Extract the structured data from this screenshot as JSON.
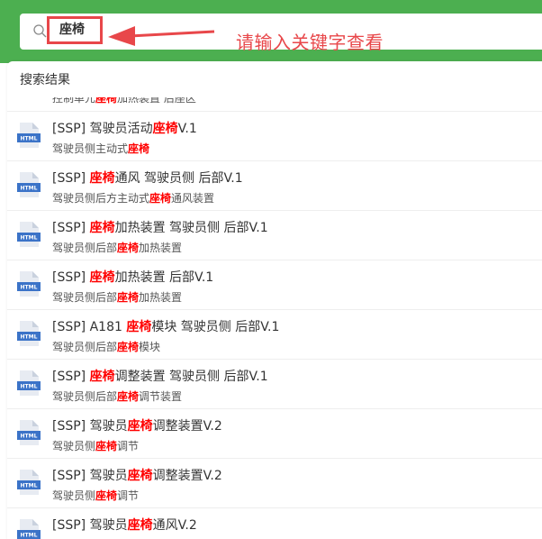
{
  "search": {
    "value": "座椅"
  },
  "hint": "请输入关键字查看",
  "results_header": "搜索结果",
  "partial_row": {
    "pre": "控制单元",
    "kw": "座椅",
    "post": "加热装置 后座区"
  },
  "colors": {
    "brand_green": "#4caf50",
    "annotation_red": "#e8474a",
    "highlight": "#ff0000"
  },
  "file_type_icon": "HTML",
  "results": [
    {
      "t_pre": "[SSP] 驾驶员活动",
      "t_kw": "座椅",
      "t_post": "V.1",
      "s_pre": "驾驶员侧主动式",
      "s_kw": "座椅",
      "s_post": ""
    },
    {
      "t_pre": "[SSP] ",
      "t_kw": "座椅",
      "t_post": "通风 驾驶员侧 后部V.1",
      "s_pre": "驾驶员侧后方主动式",
      "s_kw": "座椅",
      "s_post": "通风装置"
    },
    {
      "t_pre": "[SSP] ",
      "t_kw": "座椅",
      "t_post": "加热装置 驾驶员侧 后部V.1",
      "s_pre": "驾驶员侧后部",
      "s_kw": "座椅",
      "s_post": "加热装置"
    },
    {
      "t_pre": "[SSP] ",
      "t_kw": "座椅",
      "t_post": "加热装置 后部V.1",
      "s_pre": "驾驶员侧后部",
      "s_kw": "座椅",
      "s_post": "加热装置"
    },
    {
      "t_pre": "[SSP] A181 ",
      "t_kw": "座椅",
      "t_post": "模块 驾驶员侧 后部V.1",
      "s_pre": "驾驶员侧后部",
      "s_kw": "座椅",
      "s_post": "模块"
    },
    {
      "t_pre": "[SSP] ",
      "t_kw": "座椅",
      "t_post": "调整装置 驾驶员侧 后部V.1",
      "s_pre": "驾驶员侧后部",
      "s_kw": "座椅",
      "s_post": "调节装置"
    },
    {
      "t_pre": "[SSP] 驾驶员",
      "t_kw": "座椅",
      "t_post": "调整装置V.2",
      "s_pre": "驾驶员侧",
      "s_kw": "座椅",
      "s_post": "调节"
    },
    {
      "t_pre": "[SSP] 驾驶员",
      "t_kw": "座椅",
      "t_post": "调整装置V.2",
      "s_pre": "驾驶员侧",
      "s_kw": "座椅",
      "s_post": "调节"
    },
    {
      "t_pre": "[SSP] 驾驶员",
      "t_kw": "座椅",
      "t_post": "通风V.2",
      "s_pre": "",
      "s_kw": "",
      "s_post": ""
    }
  ]
}
